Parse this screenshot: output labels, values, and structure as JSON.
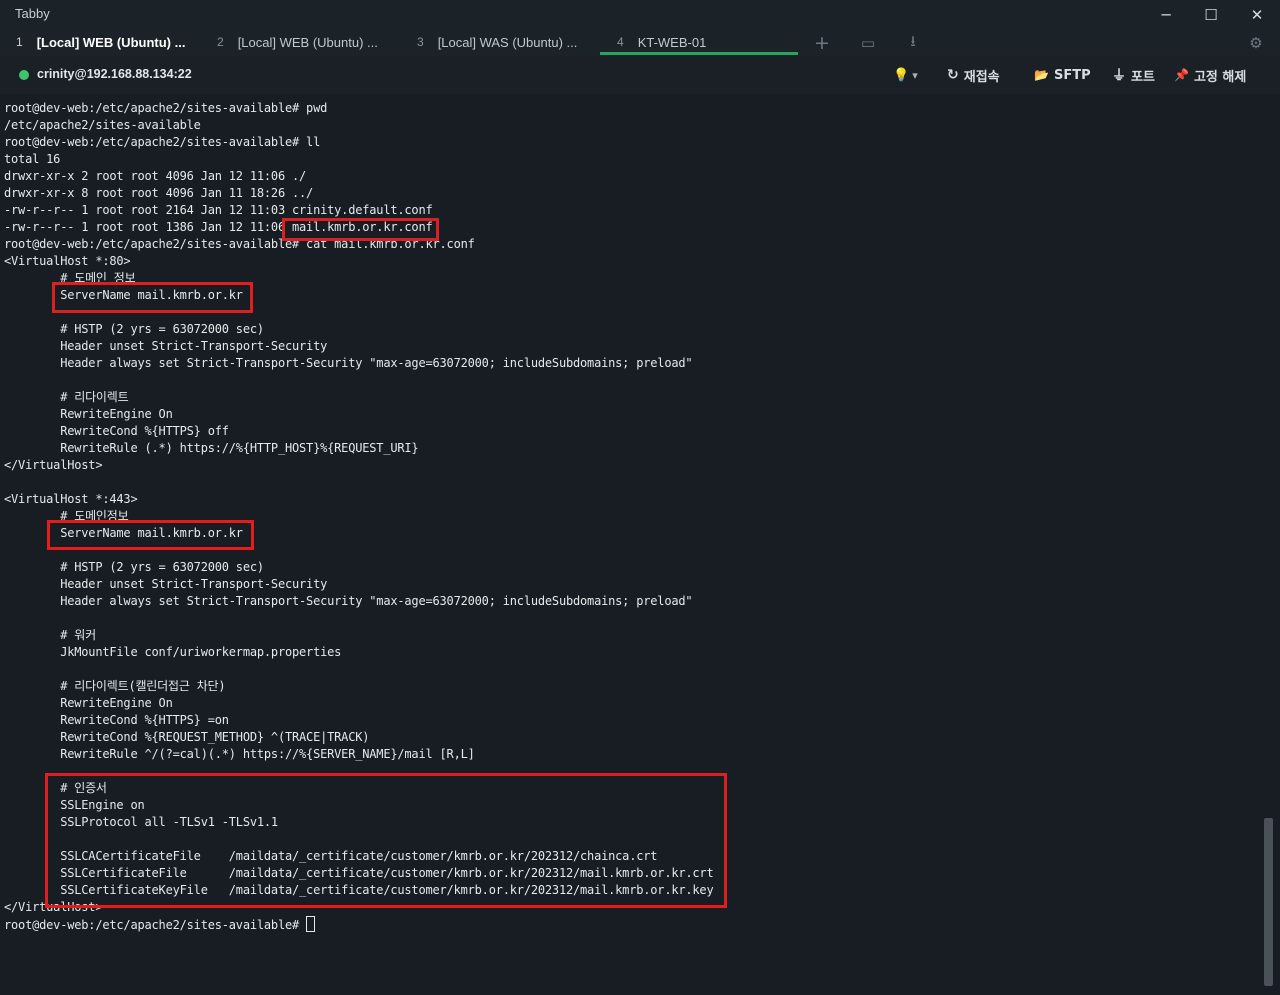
{
  "app": {
    "title": "Tabby"
  },
  "window_controls": {
    "minimize": "─",
    "maximize": "☐",
    "close": "✕"
  },
  "tabs": [
    {
      "num": "1",
      "label": "[Local] WEB (Ubuntu) ..."
    },
    {
      "num": "2",
      "label": "[Local] WEB (Ubuntu) ..."
    },
    {
      "num": "3",
      "label": "[Local] WAS (Ubuntu) ..."
    },
    {
      "num": "4",
      "label": "KT-WEB-01"
    }
  ],
  "active_tab_index": 3,
  "tab_icons": {
    "add": "+",
    "layout": "▭",
    "download": "⭳",
    "settings": "⚙"
  },
  "connection": {
    "host": "crinity@192.168.88.134:22",
    "status_color": "#3ec46d"
  },
  "toolbar": {
    "bulb_icon": "💡",
    "bulb_caret": "▾",
    "reconnect_label": "재접속",
    "reconnect_icon": "↻",
    "sftp_label": "SFTP",
    "sftp_icon": "📂",
    "ports_label": "포트",
    "ports_icon": "⏚",
    "unpin_label": "고정 해제",
    "unpin_icon": "📌"
  },
  "colors": {
    "accent": "#26a65b",
    "highlight_box": "#e01e1e",
    "terminal_bg": "#171d22",
    "terminal_fg": "#e6e8ea"
  },
  "terminal": {
    "lines": [
      "root@dev-web:/etc/apache2/sites-available# pwd",
      "/etc/apache2/sites-available",
      "root@dev-web:/etc/apache2/sites-available# ll",
      "total 16",
      "drwxr-xr-x 2 root root 4096 Jan 12 11:06 ./",
      "drwxr-xr-x 8 root root 4096 Jan 11 18:26 ../",
      "-rw-r--r-- 1 root root 2164 Jan 12 11:03 crinity.default.conf",
      "-rw-r--r-- 1 root root 1386 Jan 12 11:06 mail.kmrb.or.kr.conf",
      "root@dev-web:/etc/apache2/sites-available# cat mail.kmrb.or.kr.conf",
      "<VirtualHost *:80>",
      "        # 도메인 정보",
      "        ServerName mail.kmrb.or.kr",
      "",
      "        # HSTP (2 yrs = 63072000 sec)",
      "        Header unset Strict-Transport-Security",
      "        Header always set Strict-Transport-Security \"max-age=63072000; includeSubdomains; preload\"",
      "",
      "        # 리다이렉트",
      "        RewriteEngine On",
      "        RewriteCond %{HTTPS} off",
      "        RewriteRule (.*) https://%{HTTP_HOST}%{REQUEST_URI}",
      "</VirtualHost>",
      "",
      "<VirtualHost *:443>",
      "        # 도메인정보",
      "        ServerName mail.kmrb.or.kr",
      "",
      "        # HSTP (2 yrs = 63072000 sec)",
      "        Header unset Strict-Transport-Security",
      "        Header always set Strict-Transport-Security \"max-age=63072000; includeSubdomains; preload\"",
      "",
      "        # 워커",
      "        JkMountFile conf/uriworkermap.properties",
      "",
      "        # 리다이렉트(캘린더접근 차단)",
      "        RewriteEngine On",
      "        RewriteCond %{HTTPS} =on",
      "        RewriteCond %{REQUEST_METHOD} ^(TRACE|TRACK)",
      "        RewriteRule ^/(?=cal)(.*) https://%{SERVER_NAME}/mail [R,L]",
      "",
      "        # 인증서",
      "        SSLEngine on",
      "        SSLProtocol all -TLSv1 -TLSv1.1",
      "",
      "        SSLCACertificateFile    /maildata/_certificate/customer/kmrb.or.kr/202312/chainca.crt",
      "        SSLCertificateFile      /maildata/_certificate/customer/kmrb.or.kr/202312/mail.kmrb.or.kr.crt",
      "        SSLCertificateKeyFile   /maildata/_certificate/customer/kmrb.or.kr/202312/mail.kmrb.or.kr.key",
      "</VirtualHost>"
    ],
    "prompt": "root@dev-web:/etc/apache2/sites-available# "
  }
}
